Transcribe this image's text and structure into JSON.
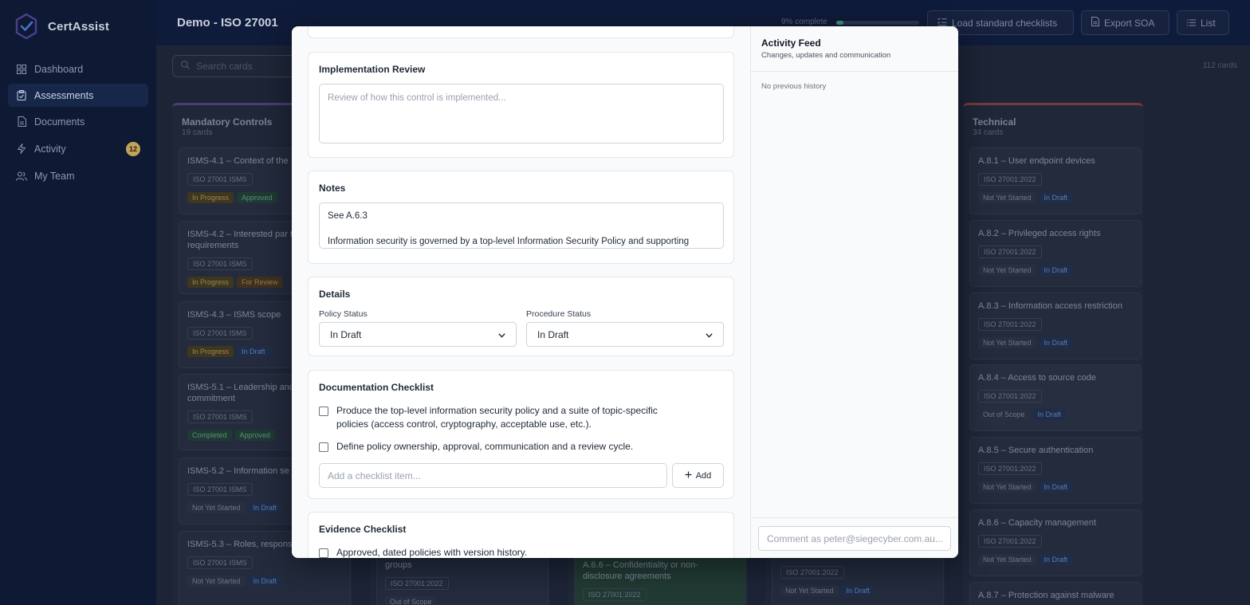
{
  "app": {
    "name": "CertAssist"
  },
  "sidebar": {
    "items": [
      {
        "label": "Dashboard",
        "icon": "dashboard-icon"
      },
      {
        "label": "Assessments",
        "icon": "clipboard-icon"
      },
      {
        "label": "Documents",
        "icon": "document-icon"
      },
      {
        "label": "Activity",
        "icon": "activity-icon",
        "badge": "12"
      },
      {
        "label": "My Team",
        "icon": "users-icon"
      }
    ]
  },
  "header": {
    "title": "Demo - ISO 27001",
    "progress_text": "9% complete",
    "progress_value": 0.09,
    "buttons": {
      "load": "Load standard checklists",
      "export": "Export SOA",
      "list": "List"
    }
  },
  "board": {
    "search_placeholder": "Search cards",
    "card_count": "112 cards",
    "columns": [
      {
        "title": "Mandatory Controls",
        "subtitle": "19 cards",
        "cards": [
          {
            "title": "ISMS-4.1 – Context of the",
            "std": "ISO 27001 ISMS",
            "status": "In Progress",
            "doc": "Approved"
          },
          {
            "title": "ISMS-4.2 – Interested par their requirements",
            "std": "ISO 27001 ISMS",
            "status": "In Progress",
            "doc": "For Review"
          },
          {
            "title": "ISMS-4.3 – ISMS scope",
            "std": "ISO 27001 ISMS",
            "status": "In Progress",
            "doc": "In Draft"
          },
          {
            "title": "ISMS-5.1 – Leadership and commitment",
            "std": "ISO 27001 ISMS",
            "status": "Completed",
            "doc": "Approved"
          },
          {
            "title": "ISMS-5.2 – Information se",
            "std": "ISO 27001 ISMS",
            "status": "Not Yet Started",
            "doc": "In Draft"
          },
          {
            "title": "ISMS-5.3 – Roles, respons authorities",
            "std": "ISO 27001 ISMS",
            "status": "Not Yet Started",
            "doc": "In Draft"
          }
        ]
      },
      {
        "title": "Technical",
        "subtitle": "34 cards",
        "cards": [
          {
            "title": "A.8.1 – User endpoint devices",
            "std": "ISO 27001:2022",
            "status": "Not Yet Started",
            "doc": "In Draft"
          },
          {
            "title": "A.8.2 – Privileged access rights",
            "std": "ISO 27001:2022",
            "status": "Not Yet Started",
            "doc": "In Draft"
          },
          {
            "title": "A.8.3 – Information access restriction",
            "std": "ISO 27001:2022",
            "status": "Not Yet Started",
            "doc": "In Draft"
          },
          {
            "title": "A.8.4 – Access to source code",
            "std": "ISO 27001:2022",
            "status": "Out of Scope",
            "doc": "In Draft"
          },
          {
            "title": "A.8.5 – Secure authentication",
            "std": "ISO 27001:2022",
            "status": "Not Yet Started",
            "doc": "In Draft"
          },
          {
            "title": "A.8.6 – Capacity management",
            "std": "ISO 27001:2022",
            "status": "Not Yet Started",
            "doc": "In Draft"
          },
          {
            "title": "A.8.7 – Protection against malware",
            "std": "",
            "status": "",
            "doc": ""
          }
        ]
      }
    ],
    "partial": {
      "col2_title": "groups",
      "col2_std": "ISO 27001:2022",
      "col2_status": "Out of Scope",
      "col3_title": "A.6.6 – Confidentiality or non-disclosure agreements",
      "col3_std": "ISO 27001:2022",
      "col4_std": "ISO 27001:2022",
      "col4_status": "Not Yet Started",
      "col4_doc": "In Draft"
    }
  },
  "modal": {
    "implementation_review": {
      "heading": "Implementation Review",
      "placeholder": "Review of how this control is implemented..."
    },
    "notes": {
      "heading": "Notes",
      "line1": "See A.6.3",
      "line2": "Information security is governed by a top-level Information Security Policy and supporting"
    },
    "details": {
      "heading": "Details",
      "policy_label": "Policy Status",
      "policy_value": "In Draft",
      "procedure_label": "Procedure Status",
      "procedure_value": "In Draft"
    },
    "documentation_checklist": {
      "heading": "Documentation Checklist",
      "items": [
        "Produce the top-level information security policy and a suite of topic-specific policies (access control, cryptography, acceptable use, etc.).",
        "Define policy ownership, approval, communication and a review cycle."
      ],
      "add_placeholder": "Add a checklist item...",
      "add_label": "Add"
    },
    "evidence_checklist": {
      "heading": "Evidence Checklist",
      "items": [
        "Approved, dated policies with version history."
      ]
    },
    "activity_feed": {
      "title": "Activity Feed",
      "subtitle": "Changes, updates and communication",
      "empty": "No previous history",
      "comment_placeholder": "Comment as peter@siegecyber.com.au..."
    }
  }
}
